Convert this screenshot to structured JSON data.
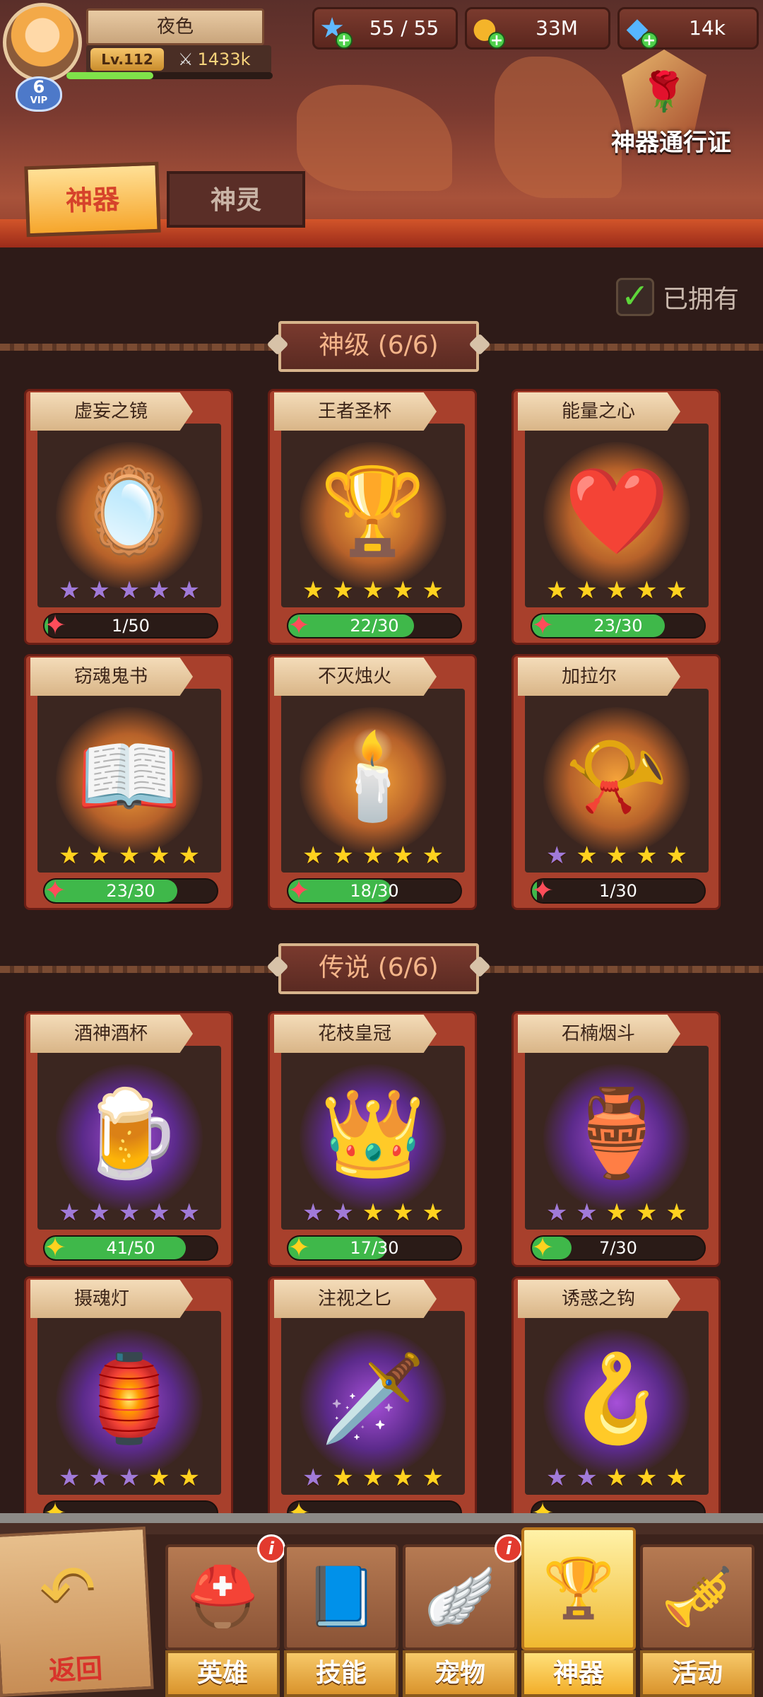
{
  "player": {
    "name": "夜色",
    "level": "Lv.112",
    "power": "1433k",
    "vip_level": "6",
    "vip_label": "VIP"
  },
  "resources": [
    {
      "icon": "stamina-star-icon",
      "value": "55 / 55"
    },
    {
      "icon": "gold-coin-icon",
      "value": "33M"
    },
    {
      "icon": "diamond-icon",
      "value": "14k"
    }
  ],
  "pass": {
    "label": "神器通行证"
  },
  "tabs": {
    "active": "神器",
    "inactive": "神灵"
  },
  "filter": {
    "owned_label": "已拥有"
  },
  "sections": [
    {
      "title": "神级 (6/6)",
      "items": [
        {
          "name": "虚妄之镜",
          "stars_gold": 0,
          "stars_purple": 5,
          "progress": "1/50",
          "fill": 0.02,
          "glow": "gold",
          "art": "🪞",
          "shard": "r"
        },
        {
          "name": "王者圣杯",
          "stars_gold": 5,
          "stars_purple": 0,
          "progress": "22/30",
          "fill": 0.73,
          "glow": "gold",
          "art": "🏆",
          "shard": "r"
        },
        {
          "name": "能量之心",
          "stars_gold": 5,
          "stars_purple": 0,
          "progress": "23/30",
          "fill": 0.77,
          "glow": "gold",
          "art": "❤️",
          "shard": "r"
        },
        {
          "name": "窃魂鬼书",
          "stars_gold": 5,
          "stars_purple": 0,
          "progress": "23/30",
          "fill": 0.77,
          "glow": "gold",
          "art": "📖",
          "shard": "r"
        },
        {
          "name": "不灭烛火",
          "stars_gold": 5,
          "stars_purple": 0,
          "progress": "18/30",
          "fill": 0.6,
          "glow": "gold",
          "art": "🕯️",
          "shard": "r"
        },
        {
          "name": "加拉尔",
          "stars_gold": 4,
          "stars_purple": 1,
          "progress": "1/30",
          "fill": 0.03,
          "glow": "gold",
          "art": "📯",
          "shard": "r"
        }
      ]
    },
    {
      "title": "传说 (6/6)",
      "items": [
        {
          "name": "酒神酒杯",
          "stars_gold": 0,
          "stars_purple": 5,
          "progress": "41/50",
          "fill": 0.82,
          "glow": "purple",
          "art": "🍺",
          "shard": "y"
        },
        {
          "name": "花枝皇冠",
          "stars_gold": 3,
          "stars_purple": 2,
          "progress": "17/30",
          "fill": 0.57,
          "glow": "purple",
          "art": "👑",
          "shard": "y"
        },
        {
          "name": "石楠烟斗",
          "stars_gold": 3,
          "stars_purple": 2,
          "progress": "7/30",
          "fill": 0.23,
          "glow": "purple",
          "art": "🏺",
          "shard": "y"
        },
        {
          "name": "摄魂灯",
          "stars_gold": 2,
          "stars_purple": 3,
          "progress": "",
          "fill": 0,
          "glow": "purple",
          "art": "🏮",
          "shard": "y"
        },
        {
          "name": "注视之匕",
          "stars_gold": 4,
          "stars_purple": 1,
          "progress": "",
          "fill": 0,
          "glow": "purple",
          "art": "🗡️",
          "shard": "y"
        },
        {
          "name": "诱惑之钩",
          "stars_gold": 3,
          "stars_purple": 2,
          "progress": "",
          "fill": 0,
          "glow": "purple",
          "art": "🪝",
          "shard": "y"
        }
      ]
    }
  ],
  "nav": {
    "back": "返回",
    "items": [
      {
        "label": "英雄",
        "icon": "helmet-icon",
        "art": "⛑️",
        "badge": "i",
        "active": false
      },
      {
        "label": "技能",
        "icon": "spellbook-icon",
        "art": "📘",
        "badge": "",
        "active": false
      },
      {
        "label": "宠物",
        "icon": "wings-icon",
        "art": "🪽",
        "badge": "i",
        "active": false
      },
      {
        "label": "神器",
        "icon": "artifact-icon",
        "art": "🏆",
        "badge": "",
        "active": true
      },
      {
        "label": "活动",
        "icon": "horn-icon",
        "art": "🎺",
        "badge": "",
        "active": false
      }
    ]
  }
}
